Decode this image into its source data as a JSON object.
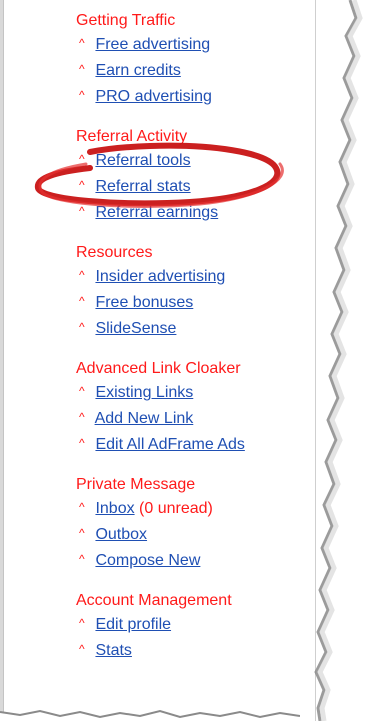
{
  "sections": [
    {
      "title": "Getting Traffic",
      "items": [
        {
          "label": "Free advertising"
        },
        {
          "label": "Earn credits"
        },
        {
          "label": "PRO advertising"
        }
      ]
    },
    {
      "title": "Referral Activity",
      "items": [
        {
          "label": "Referral tools"
        },
        {
          "label": "Referral stats"
        },
        {
          "label": "Referral earnings"
        }
      ]
    },
    {
      "title": "Resources",
      "items": [
        {
          "label": "Insider advertising"
        },
        {
          "label": "Free bonuses"
        },
        {
          "label": "SlideSense"
        }
      ]
    },
    {
      "title": "Advanced Link Cloaker",
      "items": [
        {
          "label": "Existing Links"
        },
        {
          "label": "Add New Link"
        },
        {
          "label": "Edit All AdFrame Ads"
        }
      ]
    },
    {
      "title": "Private Message",
      "items": [
        {
          "label": "Inbox",
          "note": "(0 unread)"
        },
        {
          "label": "Outbox"
        },
        {
          "label": "Compose New"
        }
      ]
    },
    {
      "title": "Account Management",
      "items": [
        {
          "label": "Edit profile"
        },
        {
          "label": "Stats"
        }
      ]
    }
  ],
  "bullet_glyph": "^",
  "colors": {
    "section_title": "#ff1a1a",
    "link": "#1f4fb3",
    "highlight": "#d01818"
  }
}
